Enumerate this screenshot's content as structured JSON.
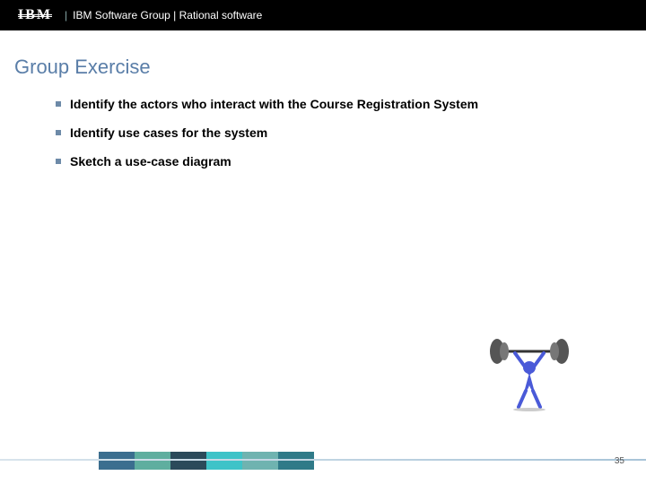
{
  "header": {
    "logo_text": "IBM",
    "subtitle": "IBM Software Group | Rational software"
  },
  "slide": {
    "title": "Group Exercise",
    "bullets": [
      "Identify the actors who interact with the Course Registration System",
      "Identify use cases for the system",
      "Sketch a use-case diagram"
    ]
  },
  "figure": {
    "name": "weightlifter-clipart"
  },
  "footer": {
    "page_number": "35",
    "strip_colors": [
      "#3b6e8f",
      "#5fae9f",
      "#2b4a5a",
      "#3ec3c8",
      "#6fb3b0",
      "#2f7a88"
    ]
  }
}
